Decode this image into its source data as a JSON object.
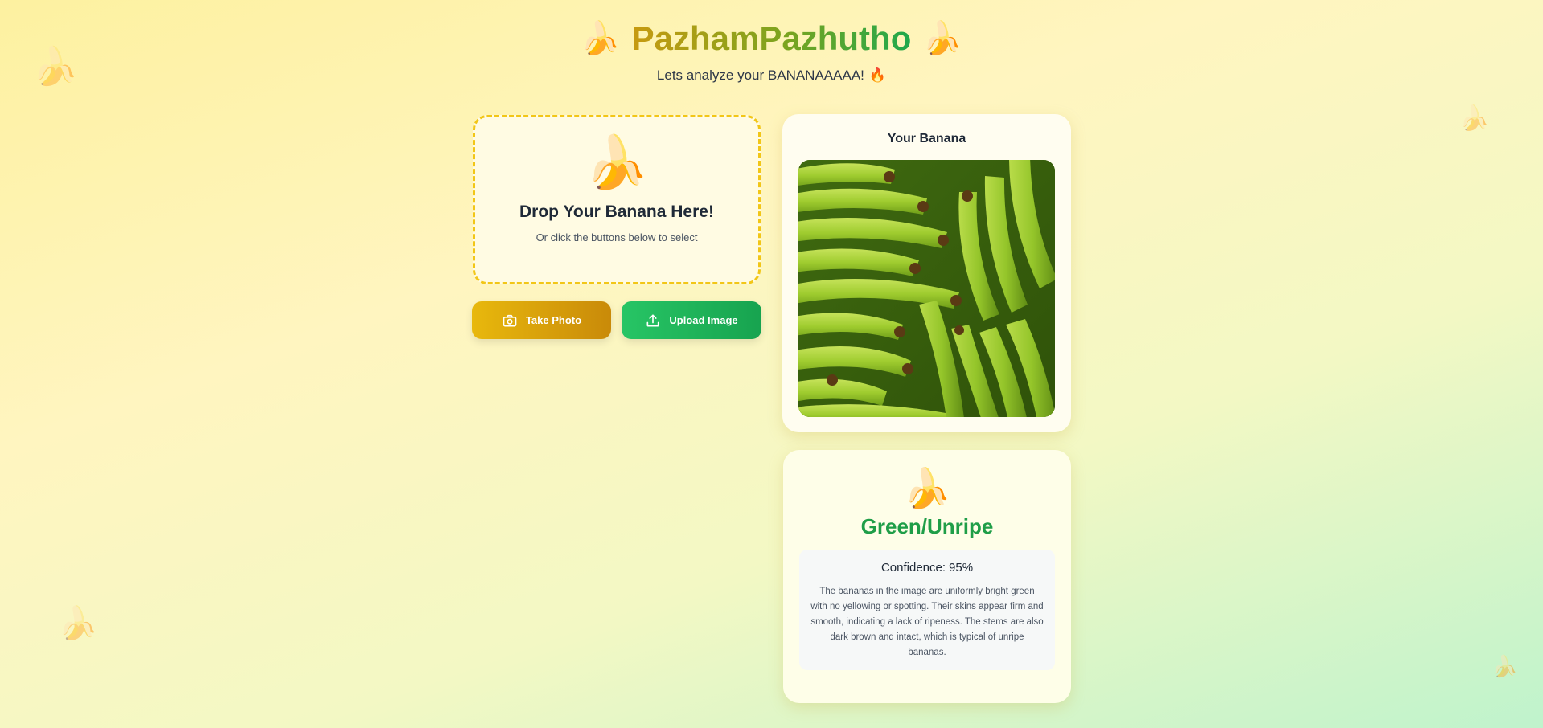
{
  "app": {
    "title": "PazhamPazhutho",
    "title_icon": "banana-icon",
    "subtitle": "Lets analyze your BANANAAAAA!",
    "subtitle_icon": "fire-icon"
  },
  "dropzone": {
    "icon": "peeled-banana-icon",
    "title": "Drop Your Banana Here!",
    "hint": "Or click the buttons below to select"
  },
  "actions": {
    "take_photo_label": "Take Photo",
    "take_photo_icon": "camera-icon",
    "upload_label": "Upload Image",
    "upload_icon": "upload-icon"
  },
  "preview": {
    "title": "Your Banana",
    "image_subject": "bunch of green bananas"
  },
  "result": {
    "icon": "peeled-banana-icon",
    "ripeness": "Green/Unripe",
    "confidence_label": "Confidence:",
    "confidence_value": "95%",
    "explanation": "The bananas in the image are uniformly bright green with no yellowing or spotting. Their skins appear firm and smooth, indicating a lack of ripeness. The stems are also dark brown and intact, which is typical of unripe bananas."
  },
  "colors": {
    "accent_yellow": "#e8b80d",
    "accent_green": "#1f9e48",
    "dropzone_border": "#f2c617"
  }
}
